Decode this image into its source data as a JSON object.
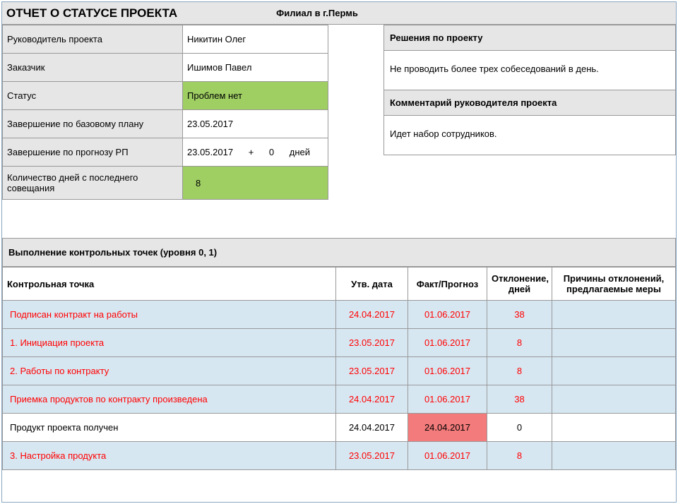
{
  "header": {
    "title": "ОТЧЕТ О СТАТУСЕ ПРОЕКТА",
    "filial": "Филиал в г.Пермь"
  },
  "info": {
    "manager_label": "Руководитель проекта",
    "manager_value": "Никитин Олег",
    "customer_label": "Заказчик",
    "customer_value": "Ишимов Павел",
    "status_label": "Статус",
    "status_value": "Проблем нет",
    "baseline_finish_label": "Завершение по базовому плану",
    "baseline_finish_value": "23.05.2017",
    "forecast_finish_label": "Завершение по прогнозу РП",
    "forecast_date": "23.05.2017",
    "forecast_plus": "+",
    "forecast_delta": "0",
    "forecast_days": "дней",
    "days_since_label": "Количество дней с последнего совещания",
    "days_since_value": "8"
  },
  "decisions": {
    "title": "Решения по проекту",
    "body": "Не проводить более трех собеседований в день."
  },
  "comment": {
    "title": "Комментарий руководителя проекта",
    "body": "Идет набор сотрудников."
  },
  "milestones": {
    "section_title": "Выполнение контрольных точек (уровня 0, 1)",
    "col_point": "Контрольная точка",
    "col_approved": "Утв. дата",
    "col_fact": "Факт/Прогноз",
    "col_dev": "Отклонение, дней",
    "col_reason": "Причины отклонений, предлагаемые меры",
    "rows": [
      {
        "name": "Подписан контракт на работы",
        "approved": "24.04.2017",
        "fact": "01.06.2017",
        "dev": "38",
        "reason": "",
        "late": true
      },
      {
        "name": "1. Инициация проекта",
        "approved": "23.05.2017",
        "fact": "01.06.2017",
        "dev": "8",
        "reason": "",
        "late": true
      },
      {
        "name": "2. Работы по контракту",
        "approved": "23.05.2017",
        "fact": "01.06.2017",
        "dev": "8",
        "reason": "",
        "late": true
      },
      {
        "name": "Приемка продуктов по контракту произведена",
        "approved": "24.04.2017",
        "fact": "01.06.2017",
        "dev": "38",
        "reason": "",
        "late": true
      },
      {
        "name": "Продукт проекта получен",
        "approved": "24.04.2017",
        "fact": "24.04.2017",
        "dev": "0",
        "reason": "",
        "late": false,
        "pinkFact": true
      },
      {
        "name": "3. Настройка продукта",
        "approved": "23.05.2017",
        "fact": "01.06.2017",
        "dev": "8",
        "reason": "",
        "late": true
      }
    ]
  }
}
